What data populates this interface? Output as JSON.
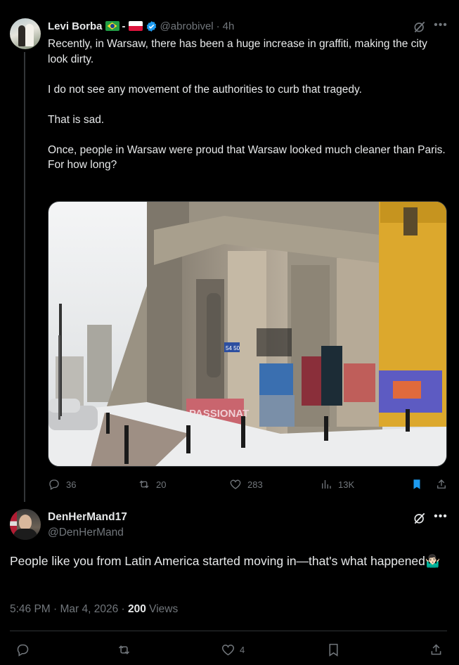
{
  "parent_tweet": {
    "author_name": "Levi Borba",
    "flags": [
      "brazil-flag",
      "poland-flag"
    ],
    "name_separator": "-",
    "handle": "@abrobivel",
    "separator": "·",
    "time": "4h",
    "text": "Recently, in Warsaw, there has been a huge increase in graffiti, making the city look dirty.\n\nI do not see any movement of the authorities to curb that tragedy.\n\nThat is sad.\n\nOnce, people in Warsaw were proud that Warsaw looked much cleaner than Paris.\nFor how long?",
    "image_graffiti_1": "PASSIONAT",
    "image_sign": "54 50",
    "stats": {
      "replies": "36",
      "reposts": "20",
      "likes": "283",
      "views": "13K"
    },
    "colors": {
      "verified": "#1d9bf0",
      "bookmark": "#1d9bf0"
    }
  },
  "reply_tweet": {
    "author_name": "DenHerMand17",
    "handle": "@DenHerMand",
    "text": "People like you from Latin America started moving in—that's what happened🤷🏻‍♂️",
    "timestamp": "5:46 PM · Mar 4, 2026",
    "meta_dot": " · ",
    "views_count": "200",
    "views_label": " Views",
    "likes": "4"
  }
}
